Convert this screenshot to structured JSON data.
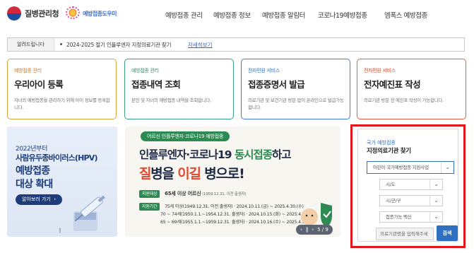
{
  "header": {
    "agency_name": "질병관리청",
    "site_logo_text": "예방접종도우미",
    "nav": [
      "예방접종 관리",
      "예방접종 정보",
      "예방접종 알림터",
      "코로나19예방접종",
      "엠폭스 예방접종"
    ]
  },
  "notice": {
    "label": "알려드립니다",
    "text": "2024-2025 절기 인플루엔자 지정의료기관 찾기",
    "link": "자세히보기"
  },
  "cards": [
    {
      "category": "예방접종 관리",
      "title": "우리아이 등록",
      "desc": "자녀의 예방접종을 관리하기 위해 아이 정보를 등록합니다."
    },
    {
      "category": "예방접종 관리",
      "title": "접종내역 조회",
      "desc": "본인 및 자녀의 예방접종 내역을 조회합니다."
    },
    {
      "category": "전자민원 서비스",
      "title": "접종증명서 발급",
      "desc": "의료기관 및 보건기관 방문 없이 온라인으로 발급가능합니다."
    },
    {
      "category": "전자민원 서비스",
      "title": "전자예진표 작성",
      "desc": "의료기관 방문 전 예진표 작성이 가능합니다."
    }
  ],
  "hpv_banner": {
    "line1": "2022년부터",
    "line2": "사람유두종바이러스(HPV)",
    "line3": "예방접종",
    "line4": "대상 확대",
    "button": "알아보러 가기",
    "pause": "‖"
  },
  "campaign": {
    "pill": "어르신 인플루엔자·코로나19 예방접종",
    "headline1_a": "인플루엔자·코로나19 ",
    "headline1_b": "동시접종",
    "headline1_c": "하고",
    "headline2_a": "질",
    "headline2_b": "병을 ",
    "headline2_c": "이길",
    "headline2_d": " 병으로!",
    "target_tag": "지원대상",
    "target_text": "65세 이상 어르신",
    "target_note": "(1959.12.31. 이전 출생자)",
    "period_tag": "지원기간",
    "period_rows": [
      "75세 이상(1949.12.31. 이전 출생자) · 2024.10.11.(금) ~ 2025.4.30.(수)",
      "70 ~ 74세(1950.1.1.~1954.12.31. 출생자) · 2024.10.15.(화) ~ 2025.4.30.(수)",
      "65 ~ 69세(1955.1.1.~1959.12.31. 출생자) · 2024.10.16.(수) ~ 2025.4.30.(수)"
    ],
    "pager": "5 / 9"
  },
  "finder": {
    "subtitle": "국가 예방접종",
    "title": "지정의료기관 찾기",
    "program_select": "어린이 국가예방접종 지원사업",
    "region_select": "시/도",
    "district_select": "시/군/구",
    "vaccine_select": "접종가능 백신",
    "name_placeholder": "의료기관명을 입력해주세",
    "search_button": "검색"
  }
}
